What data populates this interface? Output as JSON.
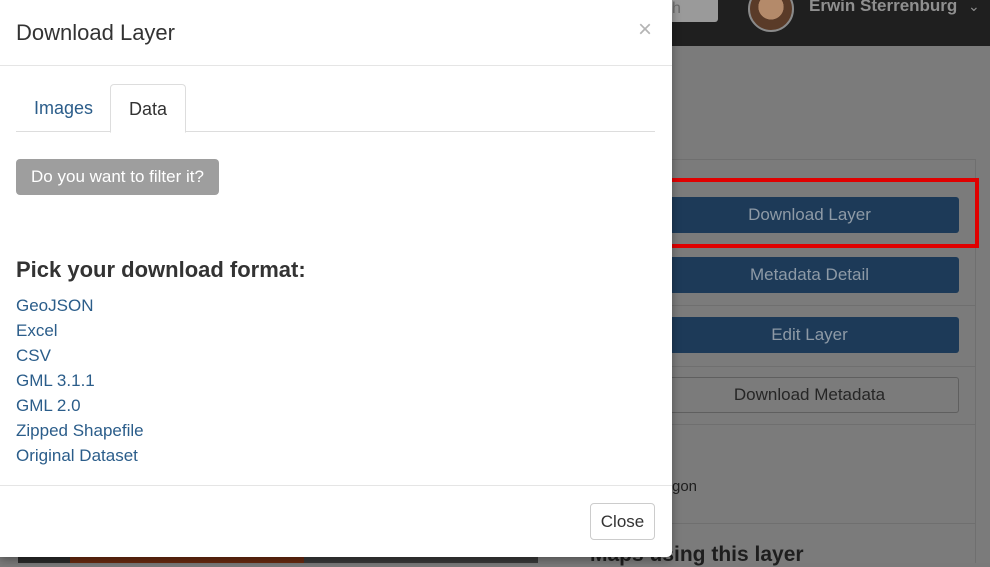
{
  "background": {
    "search_fragment": "h",
    "user_name": "Erwin Sterrenburg",
    "user_caret": "⌄",
    "buttons": {
      "download_layer": "Download Layer",
      "metadata_detail": "Metadata Detail",
      "edit_layer": "Edit Layer",
      "download_metadata": "Download Metadata"
    },
    "text_fragment": "gon",
    "heading_fragment": "Maps using this layer"
  },
  "modal": {
    "title": "Download Layer",
    "close_symbol": "×",
    "tabs": [
      {
        "label": "Images"
      },
      {
        "label": "Data"
      }
    ],
    "active_tab": "Data",
    "filter_button": "Do you want to filter it?",
    "format_title": "Pick your download format:",
    "formats": [
      "GeoJSON",
      "Excel",
      "CSV",
      "GML 3.1.1",
      "GML 2.0",
      "Zipped Shapefile",
      "Original Dataset"
    ],
    "close_button": "Close"
  },
  "colors": {
    "link": "#2b5d8a",
    "primary_button": "#1d3a58",
    "highlight": "#e00000",
    "filter_button": "#9e9e9e"
  }
}
